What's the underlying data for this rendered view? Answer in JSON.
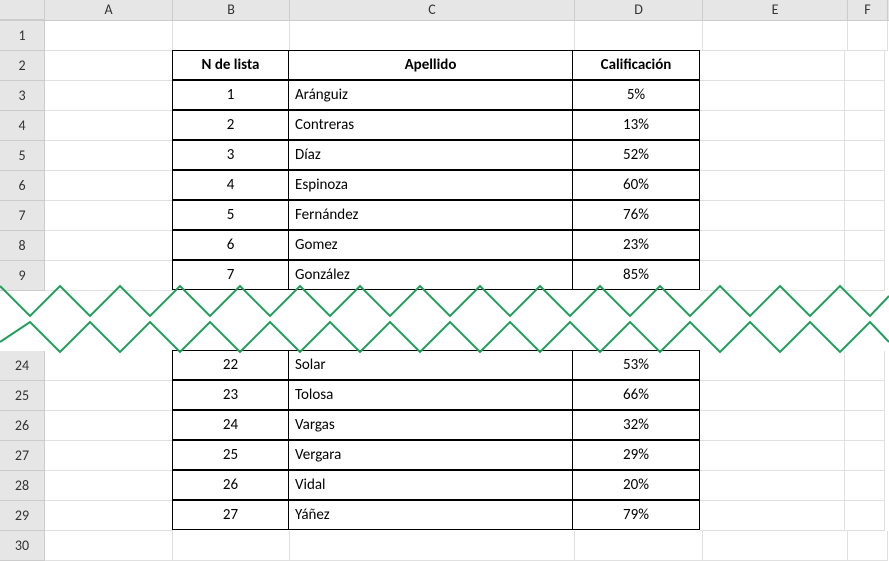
{
  "columns": [
    "A",
    "B",
    "C",
    "D",
    "E",
    "F"
  ],
  "rowNumbersTop": [
    "1",
    "2",
    "3",
    "4",
    "5",
    "6",
    "7",
    "8",
    "9"
  ],
  "rowNumbersBottom": [
    "24",
    "25",
    "26",
    "27",
    "28",
    "29",
    "30"
  ],
  "headers": {
    "num": "N de lista",
    "apellido": "Apellido",
    "calif": "Calificación"
  },
  "rowsTop": [
    {
      "num": "1",
      "apellido": "Aránguiz",
      "calif": "5%"
    },
    {
      "num": "2",
      "apellido": "Contreras",
      "calif": "13%"
    },
    {
      "num": "3",
      "apellido": "Díaz",
      "calif": "52%"
    },
    {
      "num": "4",
      "apellido": "Espinoza",
      "calif": "60%"
    },
    {
      "num": "5",
      "apellido": "Fernández",
      "calif": "76%"
    },
    {
      "num": "6",
      "apellido": "Gomez",
      "calif": "23%"
    },
    {
      "num": "7",
      "apellido": "González",
      "calif": "85%"
    }
  ],
  "rowsBottom": [
    {
      "num": "22",
      "apellido": "Solar",
      "calif": "53%"
    },
    {
      "num": "23",
      "apellido": "Tolosa",
      "calif": "66%"
    },
    {
      "num": "24",
      "apellido": "Vargas",
      "calif": "32%"
    },
    {
      "num": "25",
      "apellido": "Vergara",
      "calif": "29%"
    },
    {
      "num": "26",
      "apellido": "Vidal",
      "calif": "20%"
    },
    {
      "num": "27",
      "apellido": "Yáñez",
      "calif": "79%"
    }
  ]
}
